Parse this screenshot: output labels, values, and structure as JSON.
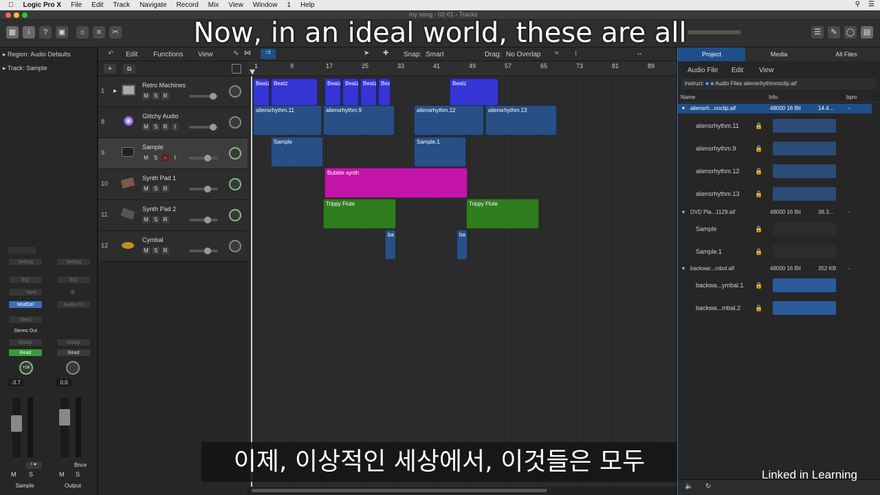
{
  "menubar": {
    "app": "Logic Pro X",
    "items": [
      "File",
      "Edit",
      "Track",
      "Navigate",
      "Record",
      "Mix",
      "View",
      "Window",
      "1",
      "Help"
    ]
  },
  "window": {
    "title": "my song - 02-01 - Tracks"
  },
  "inspector": {
    "region_label": "Region:",
    "region_value": "Audio Defaults",
    "track_label": "Track:",
    "track_value": "Sample",
    "strip1": {
      "setting": "Setting",
      "eq": "EQ",
      "input": "Input",
      "plugin": "ModDel",
      "send": "Send",
      "output": "Stereo Out",
      "group": "Group",
      "automation": "Read",
      "pan": "+16",
      "volume": "-3.7",
      "m": "M",
      "s": "S",
      "name": "Sample"
    },
    "strip2": {
      "setting": "Setting",
      "eq": "EQ",
      "plugin": "Audio FX",
      "group": "Group",
      "automation": "Read",
      "volume": "0.0",
      "bounce": "Bnce",
      "m": "M",
      "s": "S",
      "name": "Output"
    }
  },
  "tracks_toolbar": {
    "edit": "Edit",
    "functions": "Functions",
    "view": "View",
    "snap_label": "Snap:",
    "snap_value": "Smart",
    "drag_label": "Drag:",
    "drag_value": "No Overlap"
  },
  "ruler": [
    "1",
    "9",
    "17",
    "25",
    "33",
    "41",
    "49",
    "57",
    "65",
    "73",
    "81",
    "89"
  ],
  "tracks": [
    {
      "num": "1",
      "name": "Retro Machines",
      "m": "M",
      "s": "S",
      "r": "R",
      "i": ""
    },
    {
      "num": "8",
      "name": "Glitchy Audio",
      "m": "M",
      "s": "S",
      "r": "R",
      "i": "I"
    },
    {
      "num": "9",
      "name": "Sample",
      "m": "M",
      "s": "S",
      "r": "",
      "i": "I"
    },
    {
      "num": "10",
      "name": "Synth Pad 1",
      "m": "M",
      "s": "S",
      "r": "R",
      "i": ""
    },
    {
      "num": "11",
      "name": "Synth Pad 2",
      "m": "M",
      "s": "S",
      "r": "R",
      "i": ""
    },
    {
      "num": "12",
      "name": "Cymbal",
      "m": "M",
      "s": "S",
      "r": "R",
      "i": ""
    }
  ],
  "regions": {
    "beatz": [
      "Beatz",
      "Beatz",
      "Beatz",
      "Beatz",
      "Beatz",
      "Bea",
      "Beatz"
    ],
    "glitchy": [
      "aliensrhythm.11",
      "aliensrhythm.9",
      "aliensrhythm.12",
      "aliensrhythm.13"
    ],
    "sample": [
      "Sample",
      "Sample.1"
    ],
    "synth1": "Bubble synth",
    "synth2": [
      "Trippy Flute",
      "Trippy Flute"
    ],
    "cymbal": [
      "ba",
      "ba"
    ]
  },
  "browser": {
    "tabs": [
      "Project",
      "Media",
      "All Files"
    ],
    "menu": [
      "Audio File",
      "Edit",
      "View"
    ],
    "path": [
      "instruct:",
      "Audio Files",
      "aliensrhythmnoclip.aif"
    ],
    "col_name": "Name",
    "col_info": "Info",
    "col_bpm": "bpm",
    "files": [
      {
        "name": "aliensrh...noclip.aif",
        "info": "48000 16 Bit",
        "size": "14.4...",
        "bpm": "-"
      },
      {
        "name": "DVD Pla...1129.aif",
        "info": "48000 16 Bit",
        "size": "38.3...",
        "bpm": "-"
      },
      {
        "name": "backwar...mbol.aif",
        "info": "48000 16 Bit",
        "size": "352 KB",
        "bpm": "-"
      }
    ],
    "regions": [
      "aliensrhythm.11",
      "aliensrhythm.9",
      "aliensrhythm.12",
      "aliensrhythm.13",
      "Sample",
      "Sample.1",
      "backwa...ymbal.1",
      "backwa...mbal.2"
    ]
  },
  "subtitles": {
    "top": "Now, in an ideal world, these are all",
    "bottom": "이제, 이상적인 세상에서, 이것들은 모두"
  },
  "brand": "Linked in Learning"
}
